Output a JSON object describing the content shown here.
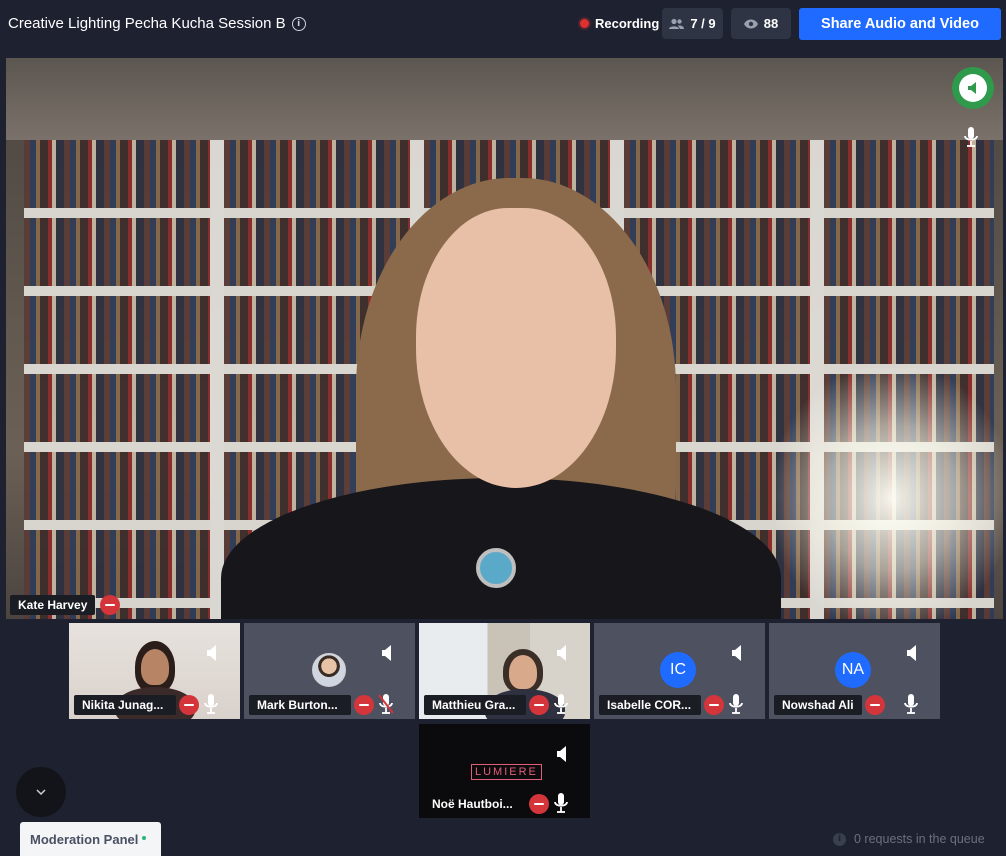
{
  "header": {
    "title": "Creative Lighting Pecha Kucha Session B",
    "recording_label": "Recording",
    "participants_count": "7 / 9",
    "viewers_count": "88",
    "share_button_label": "Share Audio and Video"
  },
  "main_speaker": {
    "name": "Kate Harvey"
  },
  "participants": [
    {
      "name": "Nikita Junag...",
      "mic": "on"
    },
    {
      "name": "Mark Burton...",
      "mic": "muted"
    },
    {
      "name": "Matthieu Gra...",
      "mic": "on"
    },
    {
      "name": "Isabelle COR...",
      "initials": "IC",
      "mic": "on"
    },
    {
      "name": "Nowshad Ali",
      "initials": "NA",
      "mic": "on"
    },
    {
      "name": "Noë Hautboi...",
      "mic": "on",
      "video_text": "LUMIERE"
    }
  ],
  "footer": {
    "moderation_panel_label": "Moderation Panel",
    "queue_text": "0 requests in the queue"
  },
  "colors": {
    "background": "#1d2130",
    "accent_blue": "#1f6bff",
    "remove_red": "#d3353b",
    "speaking_green": "#2f9a4b"
  }
}
